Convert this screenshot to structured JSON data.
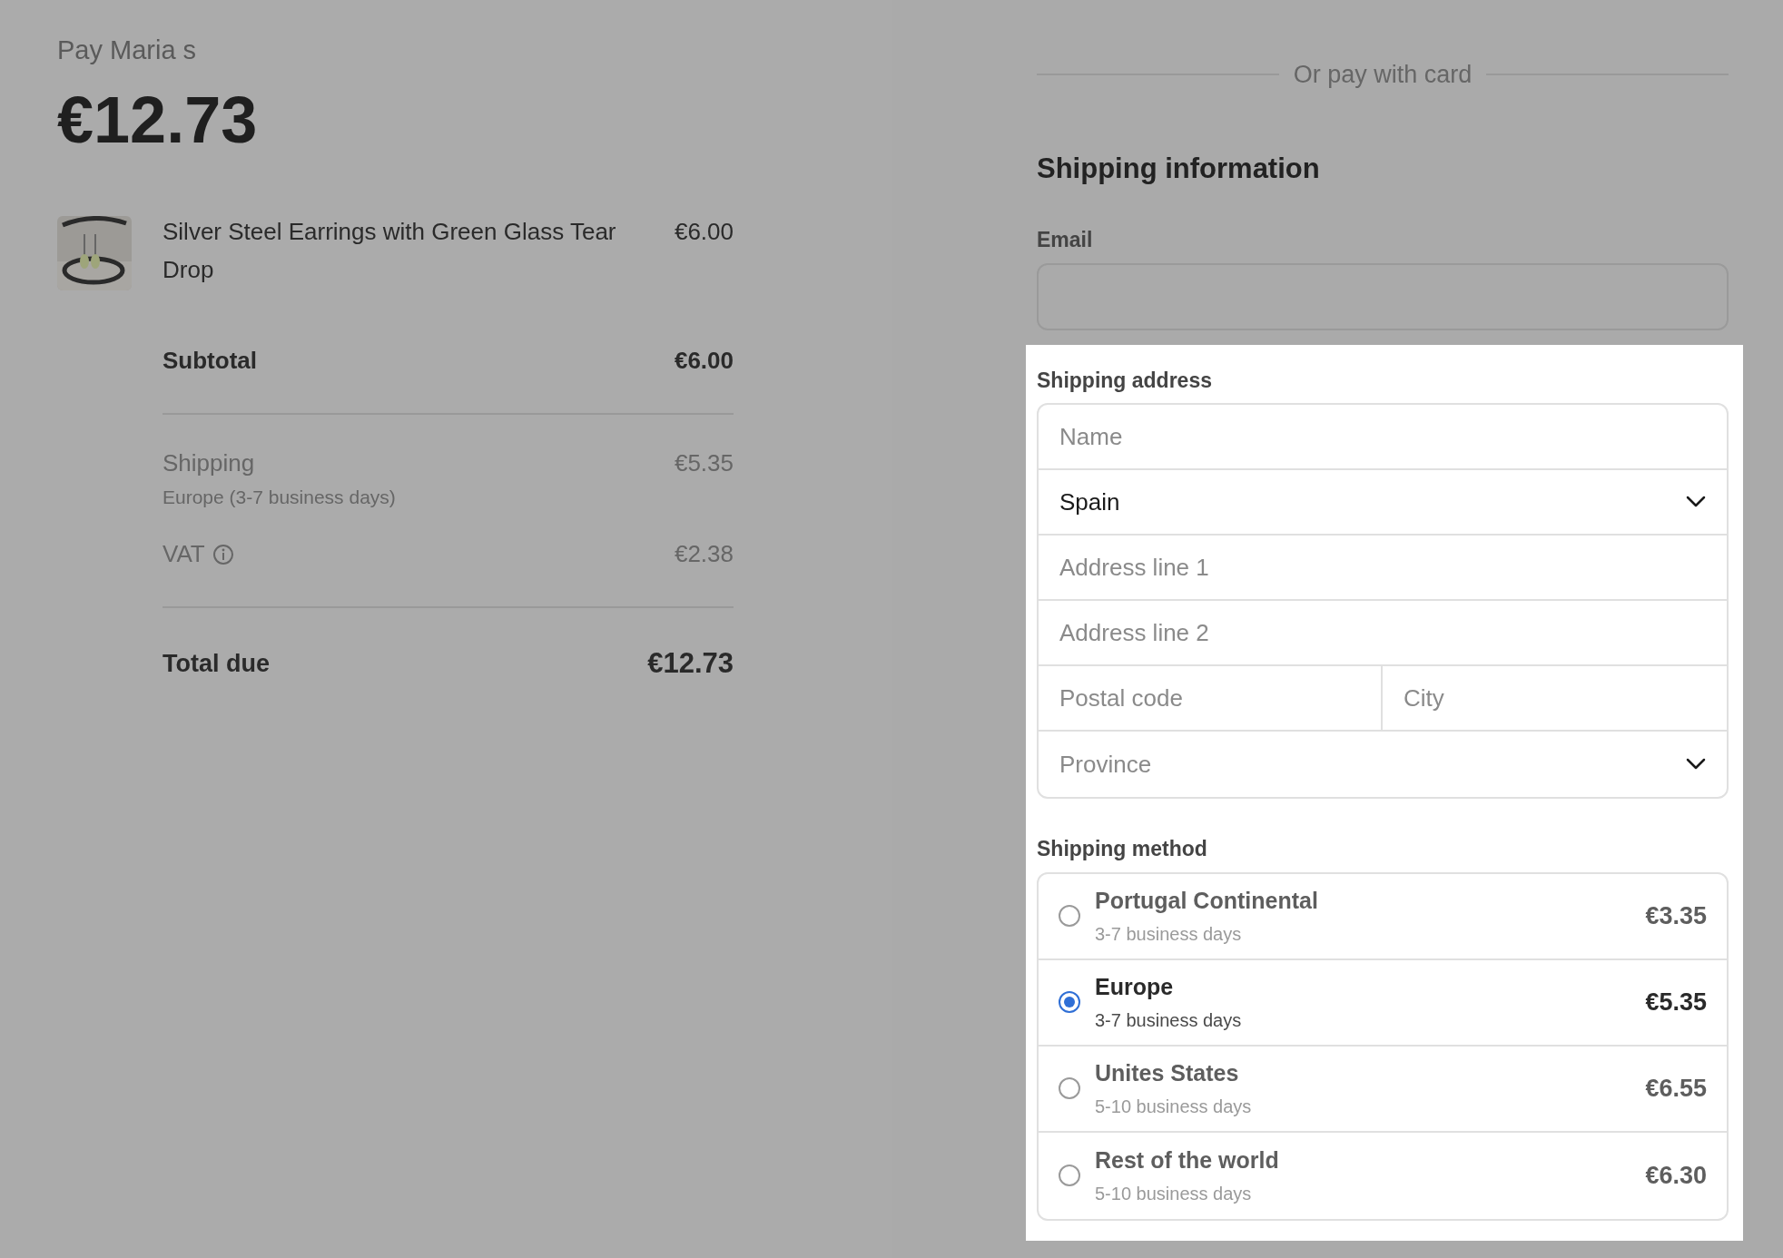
{
  "summary": {
    "merchant": "Pay Maria s",
    "amount": "€12.73",
    "items": [
      {
        "kind": "picture",
        "name": "Silver Steel Earrings with Green Glass Tear Drop",
        "price": "€6.00"
      }
    ],
    "subtotal": {
      "label": "Subtotal",
      "value": "€6.00"
    },
    "shipping": {
      "label": "Shipping",
      "detail": "Europe (3-7 business days)",
      "value": "€5.35"
    },
    "vat": {
      "label": "VAT",
      "value": "€2.38"
    },
    "total": {
      "label": "Total due",
      "value": "€12.73"
    }
  },
  "checkout": {
    "divider_text": "Or pay with card",
    "heading": "Shipping information",
    "email_label": "Email",
    "address": {
      "label": "Shipping address",
      "name_placeholder": "Name",
      "country": "Spain",
      "line1_placeholder": "Address line 1",
      "line2_placeholder": "Address line 2",
      "postal_placeholder": "Postal code",
      "city_placeholder": "City",
      "province_placeholder": "Province"
    },
    "method_label": "Shipping method",
    "methods": [
      {
        "name": "Portugal Continental",
        "days": "3-7 business days",
        "price": "€3.35",
        "selected": false
      },
      {
        "name": "Europe",
        "days": "3-7 business days",
        "price": "€5.35",
        "selected": true
      },
      {
        "name": "Unites States",
        "days": "5-10 business days",
        "price": "€6.55",
        "selected": false
      },
      {
        "name": "Rest of the world",
        "days": "5-10 business days",
        "price": "€6.30",
        "selected": false
      }
    ]
  }
}
